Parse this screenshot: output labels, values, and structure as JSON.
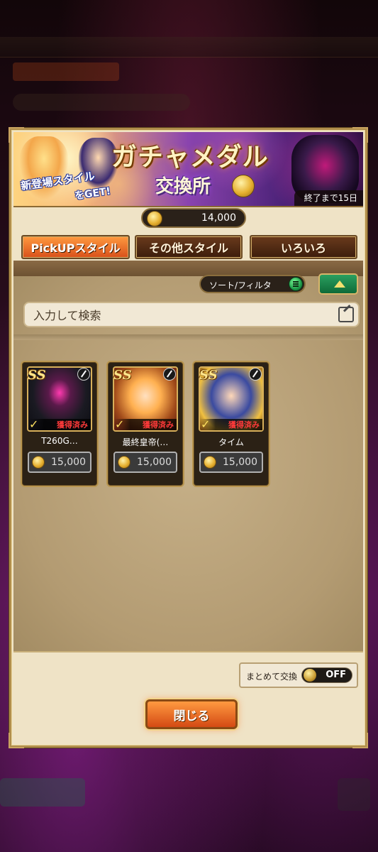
{
  "banner": {
    "title": "ガチャメダル",
    "subtitle": "交換所",
    "new_styles_line1": "新登場スタイル",
    "new_styles_line2": "をGET!",
    "remaining": "終了まで15日"
  },
  "currency": {
    "amount": "14,000",
    "icon": "medal-coin-icon"
  },
  "tabs": [
    {
      "label": "PickUPスタイル",
      "active": true
    },
    {
      "label": "その他スタイル",
      "active": false
    },
    {
      "label": "いろいろ",
      "active": false
    }
  ],
  "sort_filter": {
    "label": "ソート/フィルタ"
  },
  "search": {
    "placeholder": "入力して検索",
    "value": ""
  },
  "cards": [
    {
      "rank": "SS",
      "name": "T260G…",
      "status": "獲得済み",
      "price": "15,000",
      "weapon_icon": "sword-icon"
    },
    {
      "rank": "SS",
      "name": "最終皇帝(…",
      "status": "獲得済み",
      "price": "15,000",
      "weapon_icon": "sword-icon"
    },
    {
      "rank": "SS",
      "name": "タイム",
      "status": "獲得済み",
      "price": "15,000",
      "weapon_icon": "gun-icon"
    }
  ],
  "bulk_exchange": {
    "label": "まとめて交換",
    "state": "OFF"
  },
  "close_button": {
    "label": "閉じる"
  },
  "colors": {
    "accent_orange": "#d8501a",
    "owned_red": "#ff3a3a",
    "panel_tan": "#efe3c6"
  }
}
